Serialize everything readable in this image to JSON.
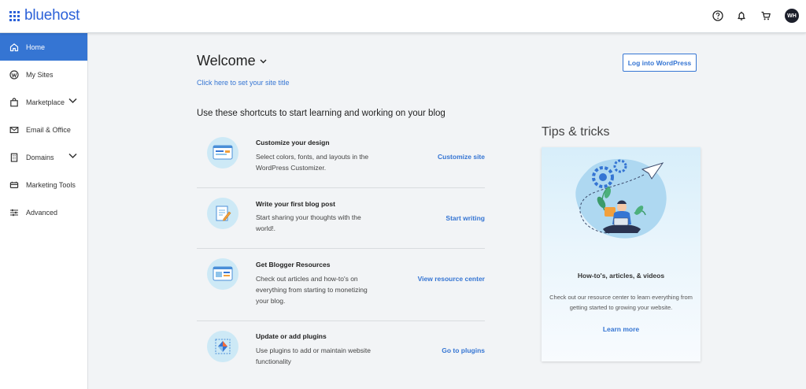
{
  "brand": {
    "name": "bluehost",
    "color": "#2d62d8"
  },
  "header": {
    "icons": [
      "help-icon",
      "bell-icon",
      "cart-icon"
    ],
    "avatar_initials": "WH"
  },
  "sidebar": {
    "items": [
      {
        "label": "Home",
        "icon": "home-icon",
        "active": true
      },
      {
        "label": "My Sites",
        "icon": "wordpress-icon"
      },
      {
        "label": "Marketplace",
        "icon": "bag-icon",
        "expandable": true
      },
      {
        "label": "Email & Office",
        "icon": "mail-icon"
      },
      {
        "label": "Domains",
        "icon": "building-icon",
        "expandable": true
      },
      {
        "label": "Marketing Tools",
        "icon": "marketing-icon"
      },
      {
        "label": "Advanced",
        "icon": "sliders-icon"
      }
    ]
  },
  "main": {
    "welcome": "Welcome",
    "site_title_link": "Click here to set your site title",
    "login_button": "Log into WordPress",
    "shortcuts_heading": "Use these shortcuts to start learning and working on your blog",
    "shortcuts": [
      {
        "title": "Customize your design",
        "description": "Select colors, fonts, and layouts in the WordPress Customizer.",
        "action": "Customize site",
        "icon": "design-icon"
      },
      {
        "title": "Write your first blog post",
        "description": "Start sharing your thoughts with the world!.",
        "action": "Start writing",
        "icon": "pencil-icon"
      },
      {
        "title": "Get Blogger Resources",
        "description": "Check out articles and how-to's on everything from starting to monetizing your blog.",
        "action": "View resource center",
        "icon": "browser-icon"
      },
      {
        "title": "Update or add plugins",
        "description": "Use plugins to add or maintain website functionality",
        "action": "Go to plugins",
        "icon": "plugin-icon"
      }
    ]
  },
  "tips": {
    "heading": "Tips & tricks",
    "title": "How-to's, articles, & videos",
    "description": "Check out our resource center to learn everything from getting started to growing your website.",
    "link": "Learn more"
  },
  "colors": {
    "accent": "#3575d3",
    "background": "#f2f4f6",
    "avatar": "#1c1f2b"
  }
}
